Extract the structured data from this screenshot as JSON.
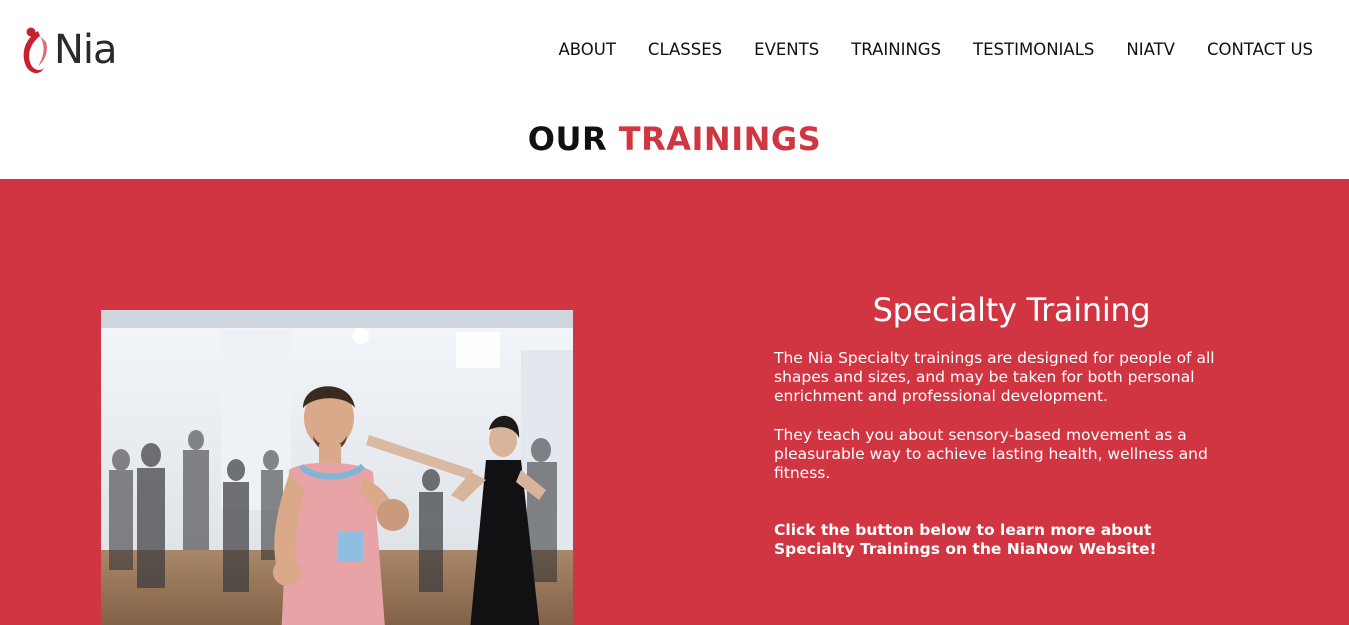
{
  "brand": {
    "logo_text": "Nia",
    "accent_color": "#d13542",
    "logo_icon": "dancer-figure-icon"
  },
  "nav": {
    "items": [
      {
        "label": "ABOUT"
      },
      {
        "label": "CLASSES"
      },
      {
        "label": "EVENTS"
      },
      {
        "label": "TRAININGS"
      },
      {
        "label": "TESTIMONIALS"
      },
      {
        "label": "NIATV"
      },
      {
        "label": "CONTACT US"
      }
    ]
  },
  "page": {
    "title_prefix": "OUR",
    "title_highlight": "TRAININGS"
  },
  "specialty": {
    "heading": "Specialty Training",
    "paragraph1": "The Nia Specialty trainings are designed for people of all shapes and sizes, and may be taken for both personal enrichment and professional development.",
    "paragraph2": "They teach you about sensory-based movement as a pleasurable way to achieve lasting health, wellness and fitness.",
    "cta_text": "Click the button below to learn more about Specialty Trainings on the NiaNow Website!",
    "photo_alt": "instructor-leading-dance-class-photo"
  }
}
